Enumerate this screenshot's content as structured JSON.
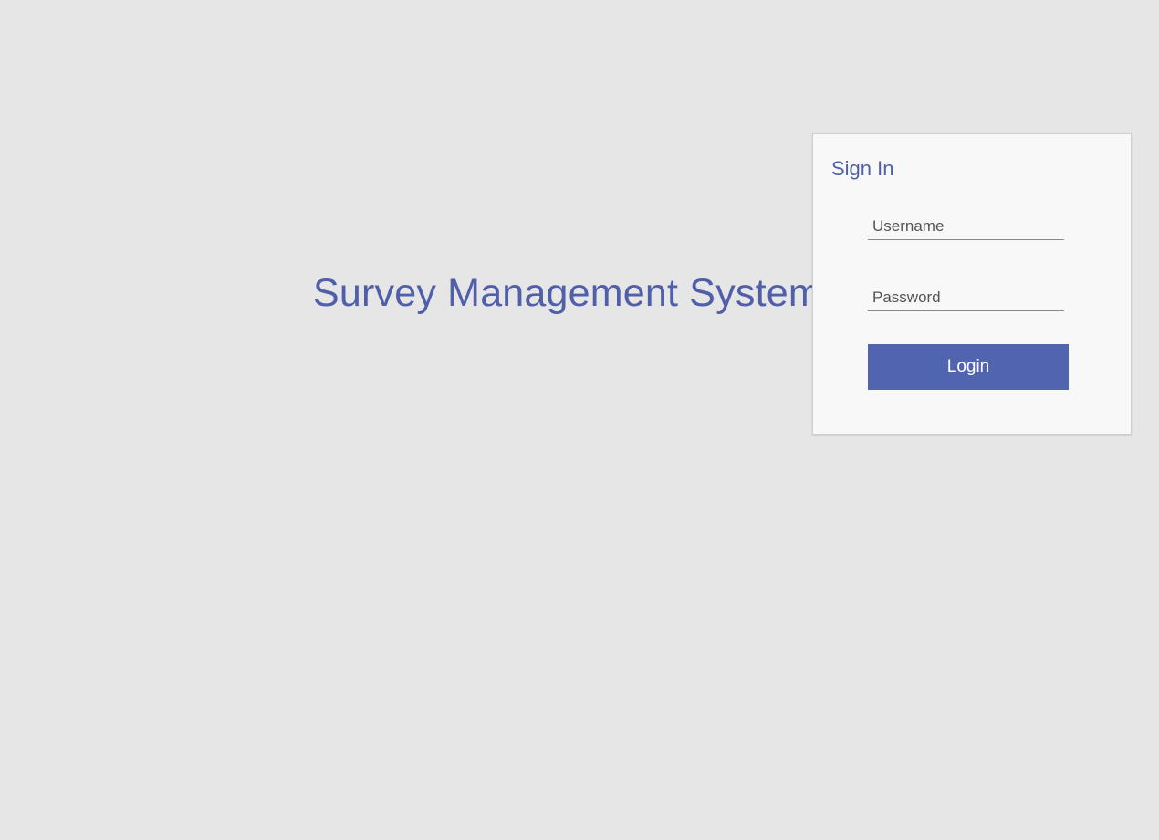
{
  "app": {
    "title": "Survey Management System"
  },
  "signin": {
    "title": "Sign In",
    "username": {
      "placeholder": "Username",
      "value": ""
    },
    "password": {
      "placeholder": "Password",
      "value": ""
    },
    "login_label": "Login"
  },
  "colors": {
    "background": "#e6e6e6",
    "panel": "#f8f8f8",
    "accent": "#5064b0",
    "title_text": "#4f5fa9"
  }
}
